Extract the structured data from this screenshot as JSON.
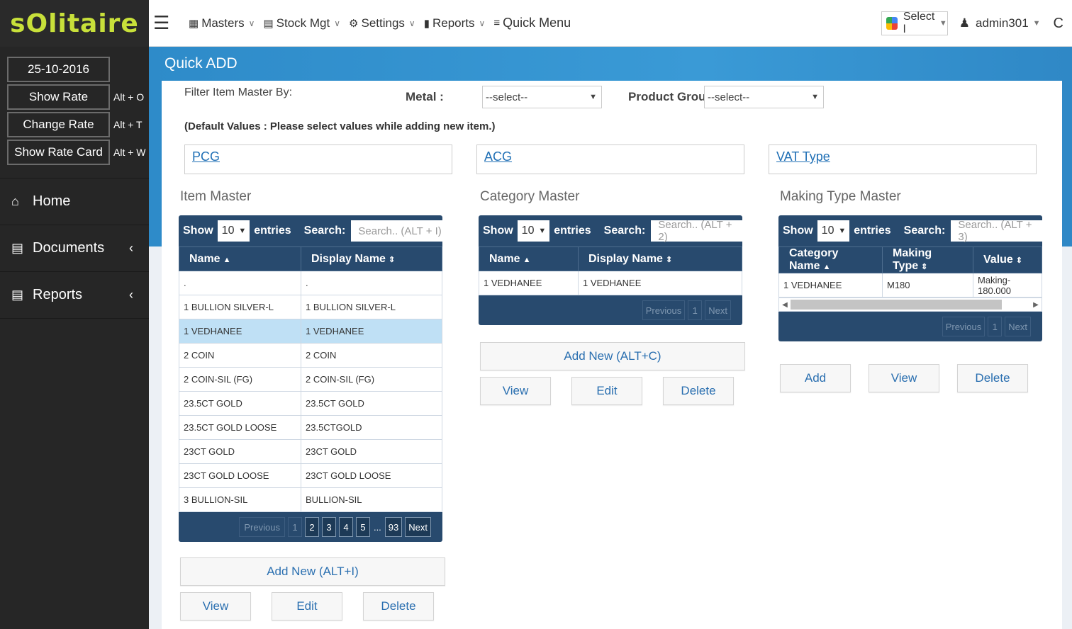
{
  "brand": {
    "logo_text": "sOlitaire"
  },
  "sidebar": {
    "date": "25-10-2016",
    "actions": [
      {
        "label": "Show Rate",
        "shortcut": "Alt + O"
      },
      {
        "label": "Change Rate",
        "shortcut": "Alt + T"
      },
      {
        "label": "Show Rate Card",
        "shortcut": "Alt + W"
      }
    ],
    "menu": [
      {
        "label": "Home",
        "icon": "home-icon"
      },
      {
        "label": "Documents",
        "icon": "bar-chart-icon"
      },
      {
        "label": "Reports",
        "icon": "bar-chart-icon"
      }
    ]
  },
  "topbar": {
    "nav": [
      {
        "label": "Masters",
        "icon": "grid-icon"
      },
      {
        "label": "Stock Mgt",
        "icon": "bar-chart-icon"
      },
      {
        "label": "Settings",
        "icon": "gear-icon"
      },
      {
        "label": "Reports",
        "icon": "document-icon"
      }
    ],
    "quick_menu": "Quick Menu",
    "translate_label": "Select l",
    "user": "admin301",
    "refresh_glyph": "C"
  },
  "page": {
    "title": "Quick ADD",
    "filter_label": "Filter Item Master By:",
    "metal_label": "Metal :",
    "metal_value": "--select--",
    "product_group_label": "Product Group :",
    "product_group_value": "--select--",
    "defaults_note": "(Default Values : Please select values while adding new item.)",
    "links": [
      "PCG",
      "ACG",
      "VAT Type"
    ]
  },
  "item_master": {
    "title": "Item Master",
    "show": "Show",
    "length": "10",
    "entries": "entries",
    "search_label": "Search:",
    "search_placeholder": "Search.. (ALT + I)",
    "columns": [
      "Name",
      "Display Name"
    ],
    "rows": [
      [
        ".",
        "."
      ],
      [
        "1 BULLION SILVER-L",
        "1 BULLION SILVER-L"
      ],
      [
        "1 VEDHANEE",
        "1 VEDHANEE"
      ],
      [
        "2 COIN",
        "2 COIN"
      ],
      [
        "2 COIN-SIL (FG)",
        "2 COIN-SIL (FG)"
      ],
      [
        "23.5CT GOLD",
        "23.5CT GOLD"
      ],
      [
        "23.5CT GOLD LOOSE",
        "23.5CTGOLD"
      ],
      [
        "23CT GOLD",
        "23CT GOLD"
      ],
      [
        "23CT GOLD LOOSE",
        "23CT GOLD LOOSE"
      ],
      [
        "3 BULLION-SIL",
        "BULLION-SIL"
      ]
    ],
    "selected_row": 2,
    "pager": {
      "previous": "Previous",
      "pages": [
        "1",
        "2",
        "3",
        "4",
        "5"
      ],
      "ellipsis": "...",
      "last": "93",
      "next": "Next"
    },
    "add_new": "Add New (ALT+I)",
    "view": "View",
    "edit": "Edit",
    "delete": "Delete"
  },
  "category_master": {
    "title": "Category Master",
    "show": "Show",
    "length": "10",
    "entries": "entries",
    "search_label": "Search:",
    "search_placeholder": "Search.. (ALT + 2)",
    "columns": [
      "Name",
      "Display Name"
    ],
    "rows": [
      [
        "1 VEDHANEE",
        "1 VEDHANEE"
      ]
    ],
    "pager": {
      "previous": "Previous",
      "page": "1",
      "next": "Next"
    },
    "add_new": "Add New (ALT+C)",
    "view": "View",
    "edit": "Edit",
    "delete": "Delete"
  },
  "making_type_master": {
    "title": "Making Type Master",
    "show": "Show",
    "length": "10",
    "entries": "entries",
    "search_label": "Search:",
    "search_placeholder": "Search.. (ALT + 3)",
    "columns": [
      "Category Name",
      "Making Type",
      "Value"
    ],
    "rows": [
      [
        "1 VEDHANEE",
        "M180",
        "Making-180.000"
      ]
    ],
    "pager": {
      "previous": "Previous",
      "page": "1",
      "next": "Next"
    },
    "add": "Add",
    "view": "View",
    "delete": "Delete"
  }
}
